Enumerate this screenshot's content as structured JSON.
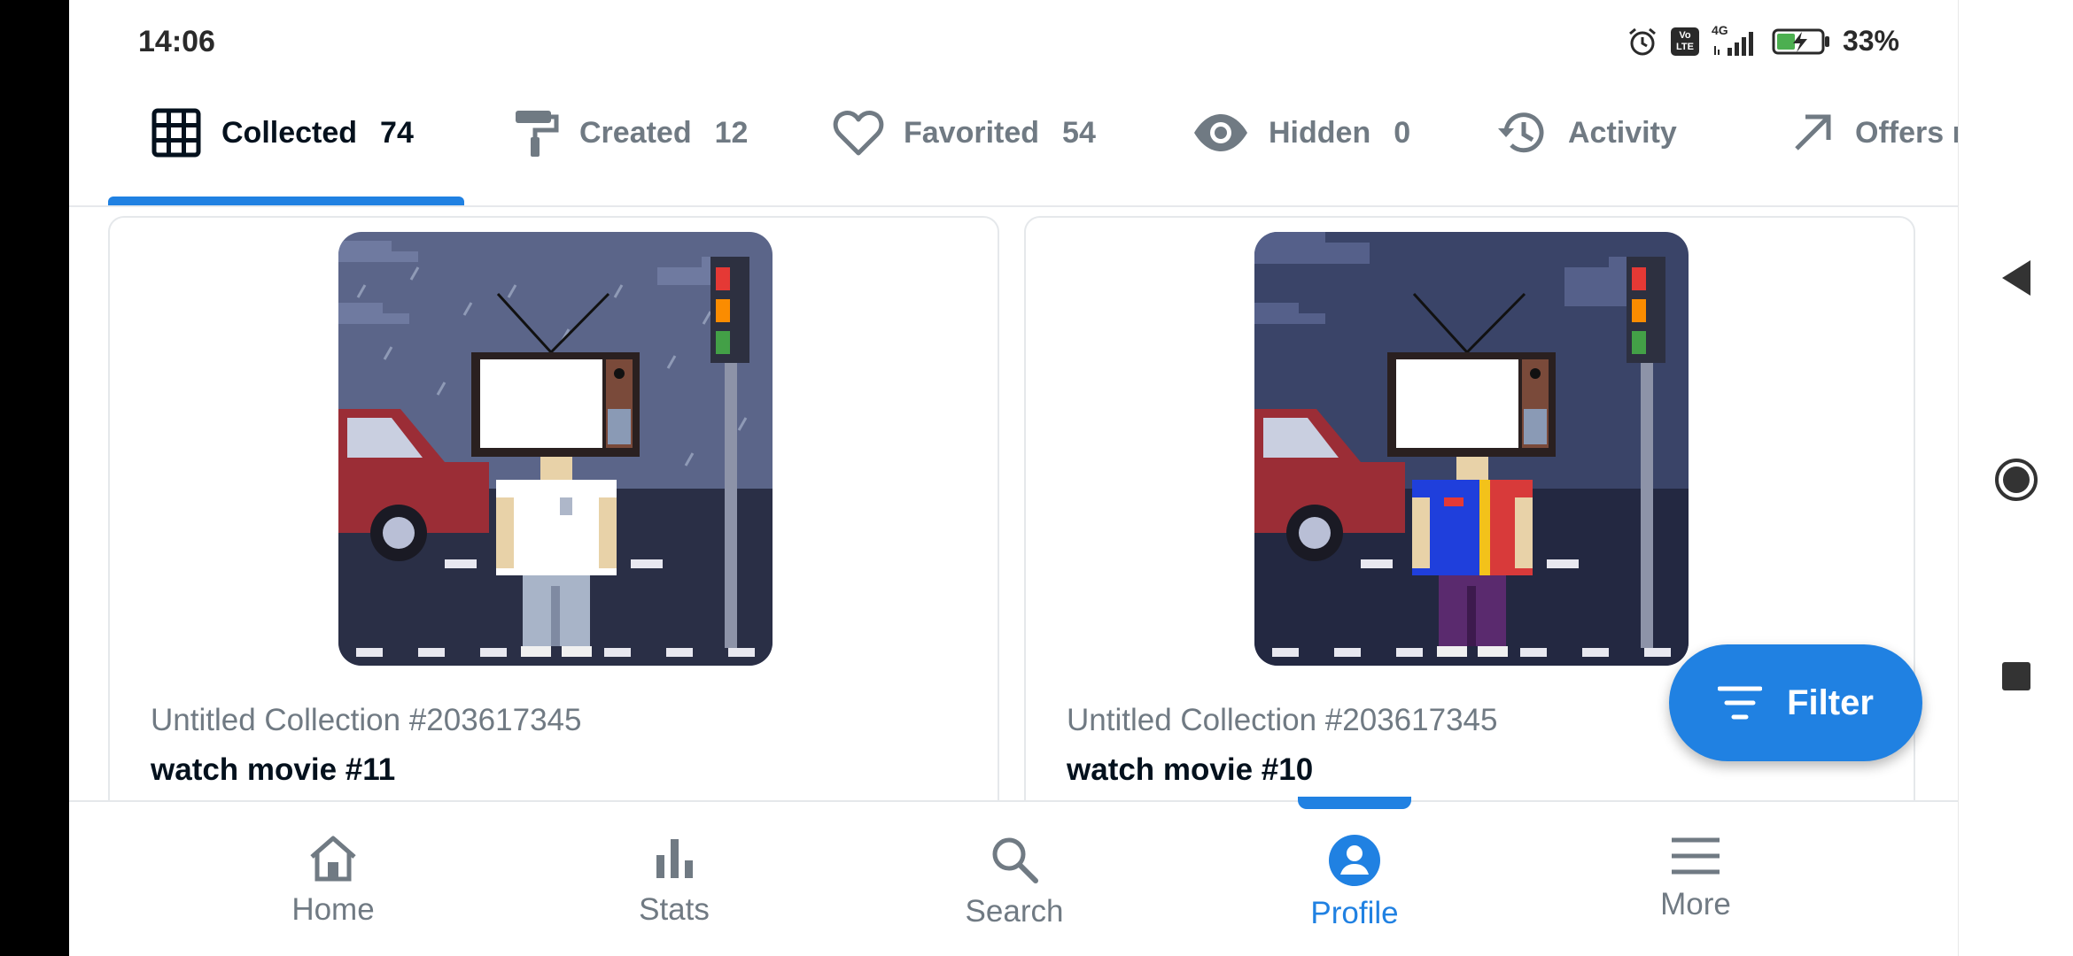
{
  "status_bar": {
    "time": "14:06",
    "network": "4G",
    "volte": "Vo LTE",
    "battery": "33%"
  },
  "tabs": [
    {
      "label": "Collected",
      "count": "74",
      "icon": "grid-icon",
      "active": true
    },
    {
      "label": "Created",
      "count": "12",
      "icon": "paint-roller-icon",
      "active": false
    },
    {
      "label": "Favorited",
      "count": "54",
      "icon": "heart-icon",
      "active": false
    },
    {
      "label": "Hidden",
      "count": "0",
      "icon": "eye-icon",
      "active": false
    },
    {
      "label": "Activity",
      "count": "",
      "icon": "history-icon",
      "active": false
    },
    {
      "label": "Offers r",
      "count": "",
      "icon": "arrow-up-right-icon",
      "active": false
    }
  ],
  "cards": [
    {
      "collection": "Untitled Collection #203617345",
      "title": "watch movie #11"
    },
    {
      "collection": "Untitled Collection #203617345",
      "title": "watch movie #10"
    }
  ],
  "filter": {
    "label": "Filter",
    "icon": "filter-icon"
  },
  "bottom_nav": [
    {
      "label": "Home",
      "icon": "home-icon"
    },
    {
      "label": "Stats",
      "icon": "bar-chart-icon"
    },
    {
      "label": "Search",
      "icon": "search-icon"
    },
    {
      "label": "Profile",
      "icon": "profile-icon",
      "active": true
    },
    {
      "label": "More",
      "icon": "menu-icon"
    }
  ],
  "colors": {
    "accent": "#2081e2",
    "text_primary": "#04111d",
    "text_secondary": "#707a83"
  }
}
